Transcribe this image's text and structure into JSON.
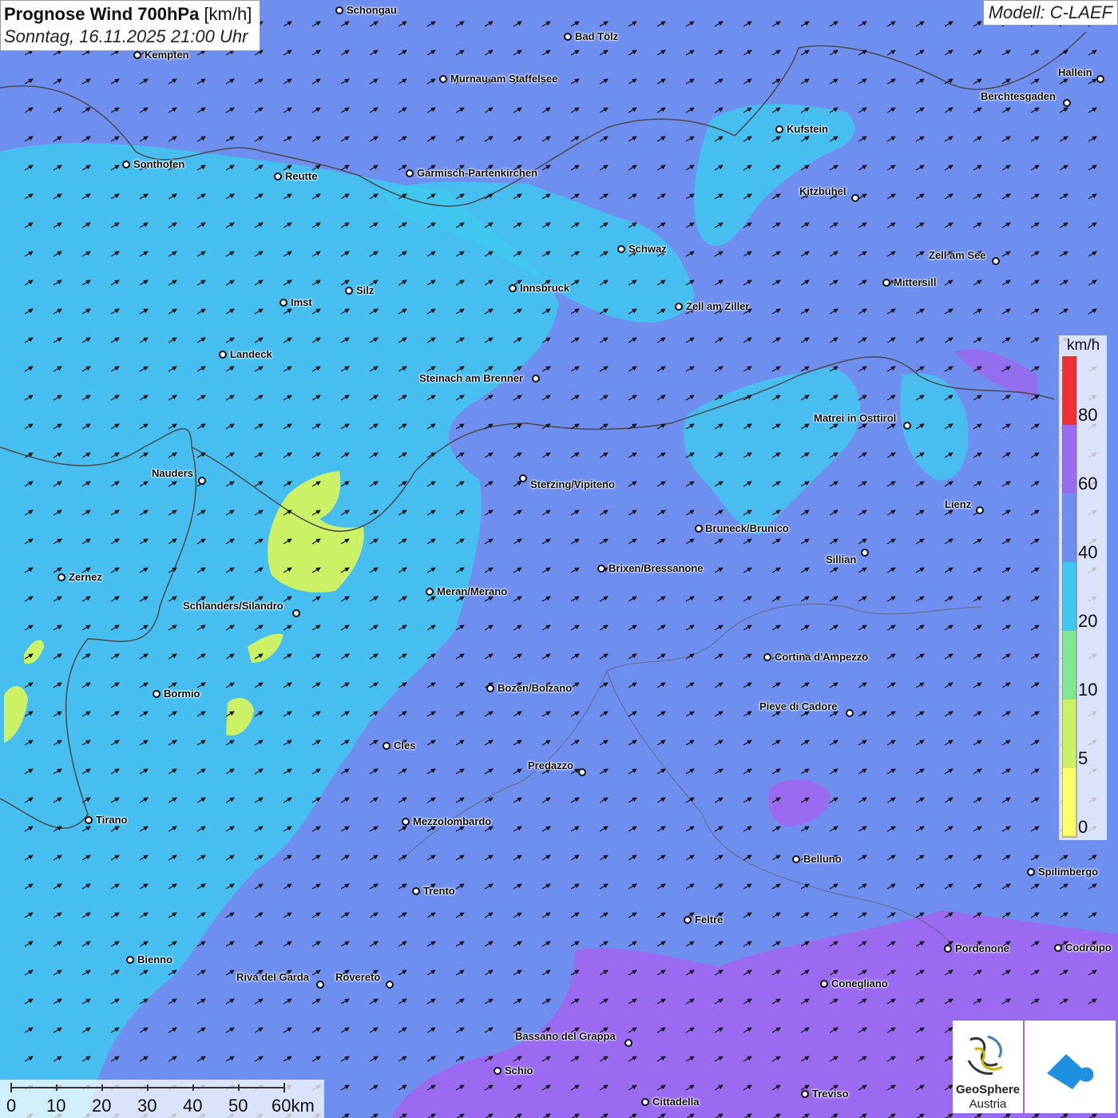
{
  "header": {
    "title_bold": "Prognose Wind 700hPa",
    "title_unit": "[km/h]",
    "datetime": "Sonntag, 16.11.2025 21:00 Uhr"
  },
  "model_label": "Modell: C-LAEF",
  "colors": {
    "wind_0": "#ffff66",
    "wind_5": "#ccf066",
    "wind_10": "#80e890",
    "wind_20": "#40c8f0",
    "wind_40": "#6f8ff0",
    "wind_60": "#9a6af0",
    "wind_80": "#ee3030",
    "arrow": "#111111",
    "border": "#4a4a4a"
  },
  "legend": {
    "unit": "km/h",
    "ticks": [
      "80",
      "60",
      "40",
      "20",
      "10",
      "5",
      "0"
    ]
  },
  "cities": [
    "Schongau",
    "Bad Tölz",
    "Kempten",
    "Murnau am Staffelsee",
    "Hallein",
    "Berchtesgaden",
    "Kufstein",
    "Sonthofen",
    "Reutte",
    "Garmisch-Partenkirchen",
    "Kitzbühel",
    "Schwaz",
    "Zell am See",
    "Imst",
    "Silz",
    "Innsbruck",
    "Mittersill",
    "Zell am Ziller",
    "Landeck",
    "Steinach am Brenner",
    "Matrei in Osttirol",
    "Nauders",
    "Sterzing/Vipiteno",
    "Lienz",
    "Bruneck/Brunico",
    "Sillian",
    "Zernez",
    "Brixen/Bressanone",
    "Meran/Merano",
    "Schlanders/Silandro",
    "Cortina d'Ampezzo",
    "Bozen/Bolzano",
    "Bormio",
    "Pieve di Cadore",
    "Cles",
    "Predazzo",
    "Tirano",
    "Mezzolombardo",
    "Belluno",
    "Spilimbergo",
    "Trento",
    "Feltre",
    "Pordenone",
    "Codroipo",
    "Bienno",
    "Riva del Garda",
    "Rovereto",
    "Conegliano",
    "Bassano del Grappa",
    "Schio",
    "Treviso",
    "Cittadella"
  ],
  "scale_bar": {
    "labels": [
      "0",
      "10",
      "20",
      "30",
      "40",
      "50",
      "60km"
    ]
  },
  "logo": {
    "name_line1": "GeoSphere",
    "name_line2": "Austria"
  },
  "wind_arrow_direction": "north-east"
}
